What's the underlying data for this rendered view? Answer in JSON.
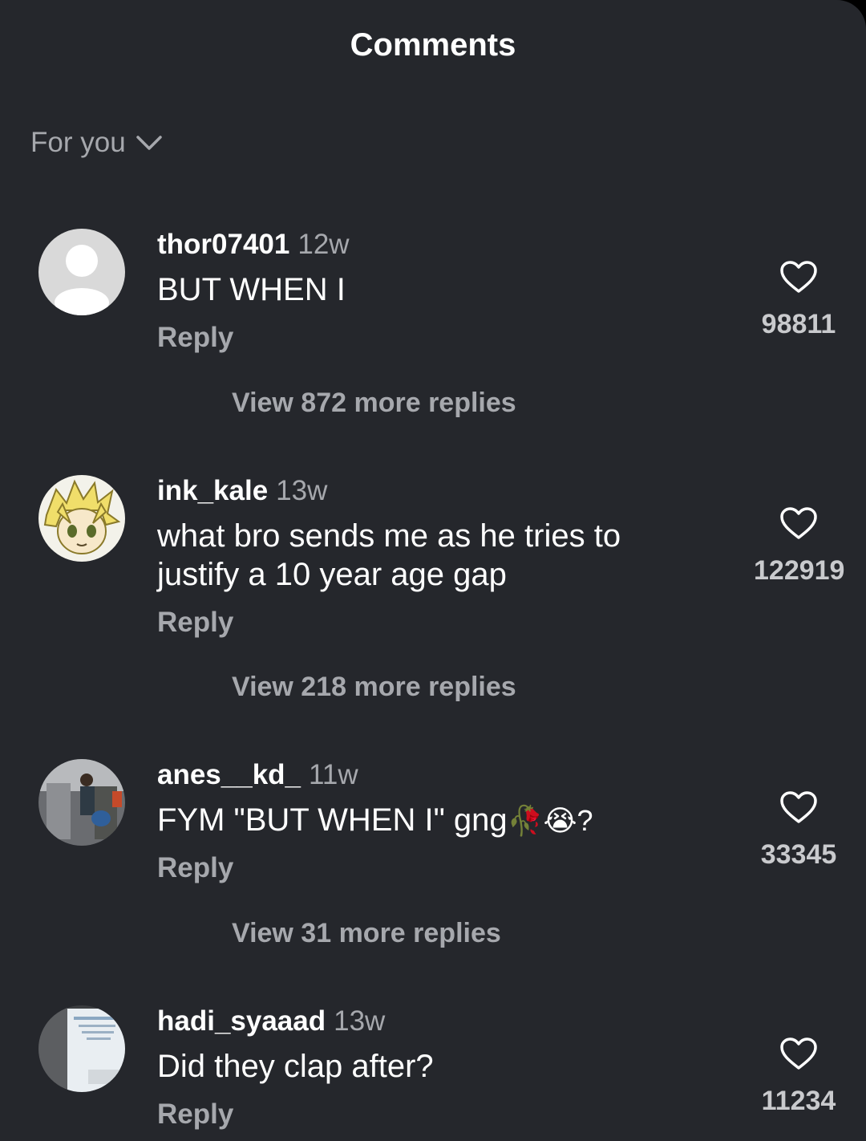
{
  "header": {
    "title": "Comments"
  },
  "sort": {
    "label": "For you"
  },
  "comments": [
    {
      "username": "thor07401",
      "time": "12w",
      "text": "BUT WHEN I",
      "reply_label": "Reply",
      "more_replies": "View 872 more replies",
      "likes": "98811",
      "avatar": "default-avatar"
    },
    {
      "username": "ink_kale",
      "time": "13w",
      "text": "what bro sends me as he tries to justify a 10 year age gap",
      "reply_label": "Reply",
      "more_replies": "View 218 more replies",
      "likes": "122919",
      "avatar": "anime-character-avatar"
    },
    {
      "username": "anes__kd_",
      "time": "11w",
      "text": "FYM \"BUT WHEN I\" gng",
      "text_suffix": "🥀😭?",
      "reply_label": "Reply",
      "more_replies": "View 31 more replies",
      "likes": "33345",
      "avatar": "photo-avatar"
    },
    {
      "username": "hadi_syaaad",
      "time": "13w",
      "text": "Did they clap after?",
      "reply_label": "Reply",
      "likes": "11234",
      "avatar": "photo-avatar"
    }
  ],
  "colors": {
    "background": "#25272c",
    "primary_text": "#ffffff",
    "secondary_text": "#a6a8ad"
  }
}
